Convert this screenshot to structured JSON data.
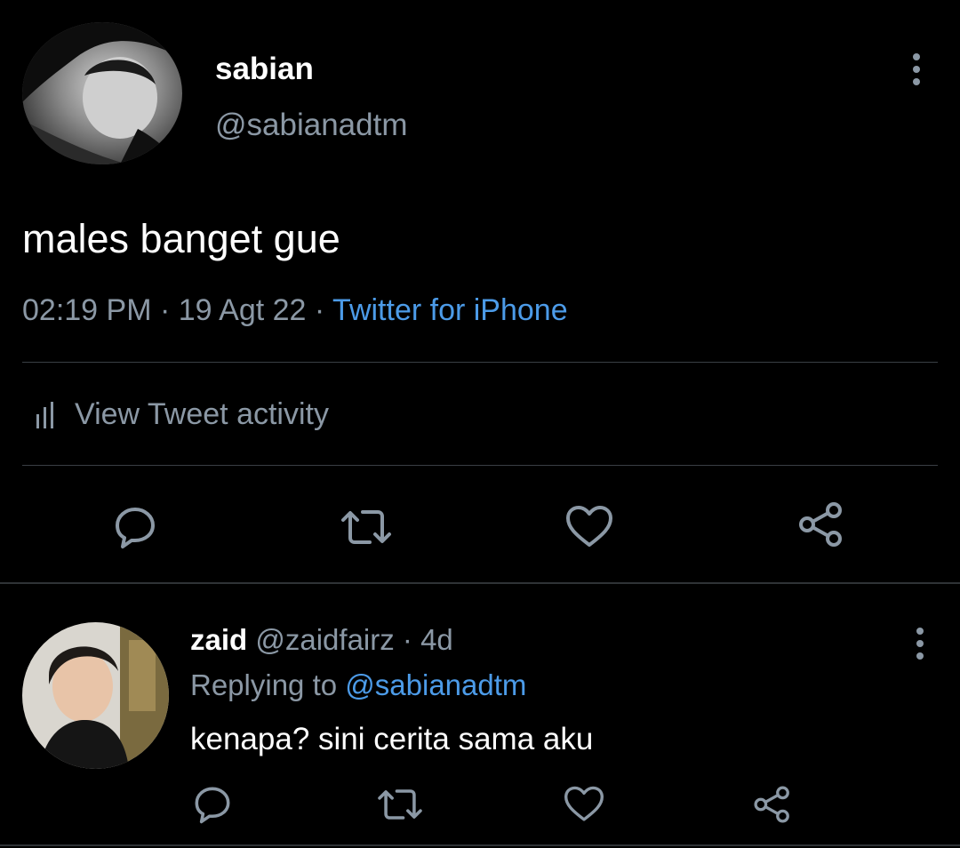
{
  "main_tweet": {
    "display_name": "sabian",
    "handle": "@sabianadtm",
    "text": "males banget gue",
    "time": "02:19 PM",
    "date": "19 Agt 22",
    "source": "Twitter for iPhone",
    "separator": " · ",
    "activity_label": "View Tweet activity",
    "avatar_icon": "profile-photo-monochrome"
  },
  "reply": {
    "display_name": "zaid",
    "handle": "@zaidfairz",
    "age": "4d",
    "separator": " · ",
    "replying_label": "Replying to",
    "replying_to": "@sabianadtm",
    "text": "kenapa? sini cerita sama aku",
    "avatar_icon": "profile-photo-color"
  },
  "icons": {
    "reply": "reply-icon",
    "retweet": "retweet-icon",
    "like": "heart-icon",
    "share": "share-icon",
    "more": "more-vertical-icon",
    "activity": "bar-chart-icon"
  },
  "colors": {
    "background": "#000000",
    "text_primary": "#ffffff",
    "text_secondary": "#8b98a5",
    "link": "#4c9be8",
    "divider": "#3a3f44"
  }
}
